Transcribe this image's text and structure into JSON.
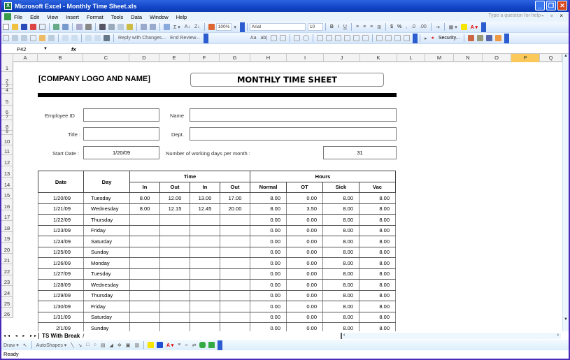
{
  "window": {
    "title": "Microsoft Excel - Monthly Time Sheet.xls",
    "app_icon": "excel-icon"
  },
  "menu": {
    "items": [
      "File",
      "Edit",
      "View",
      "Insert",
      "Format",
      "Tools",
      "Data",
      "Window",
      "Help"
    ],
    "help_placeholder": "Type a question for help",
    "doc_controls": "- ▫ ×"
  },
  "toolbar_standard": {
    "zoom": "100%"
  },
  "toolbar_formatting": {
    "font": "Arial",
    "font_size": "10",
    "bold": "B",
    "italic": "I",
    "underline": "U",
    "currency": "$",
    "percent": "%"
  },
  "toolbar_reviewing": {
    "reply_label": "Reply with Changes...",
    "end_review_label": "End Review..."
  },
  "toolbar_security": {
    "security_label": "Security..."
  },
  "formula_bar": {
    "cell_ref": "P42",
    "fx": "fx",
    "content": ""
  },
  "columns": [
    "A",
    "B",
    "C",
    "D",
    "E",
    "F",
    "G",
    "H",
    "I",
    "J",
    "K",
    "L",
    "M",
    "N",
    "O",
    "P",
    "Q"
  ],
  "selected_column": "P",
  "rows": [
    "1",
    "2",
    "3",
    "4",
    "5",
    "6",
    "7",
    "8",
    "9",
    "10",
    "11",
    "12",
    "13",
    "14",
    "15",
    "16",
    "17",
    "18",
    "19",
    "20",
    "21",
    "22",
    "23",
    "24",
    "25",
    "26"
  ],
  "sheet": {
    "company": "[COMPANY LOGO AND NAME]",
    "title": "MONTHLY TIME SHEET",
    "fields": {
      "employee_id_label": "Employee ID",
      "employee_id": "",
      "name_label": "Name",
      "name": "",
      "title_label": "Title :",
      "title": "",
      "dept_label": "Dept.",
      "dept": "",
      "start_date_label": "Start Date :",
      "start_date": "1/20/09",
      "working_days_label": "Number of working days per month :",
      "working_days": "31"
    },
    "table": {
      "h_date": "Date",
      "h_day": "Day",
      "h_time": "Time",
      "h_hours": "Hours",
      "time_cols": [
        "In",
        "Out",
        "In",
        "Out"
      ],
      "hours_cols": [
        "Normal",
        "OT",
        "Sick",
        "Vac"
      ],
      "rows": [
        {
          "date": "1/20/09",
          "day": "Tuesday",
          "in1": "8.00",
          "out1": "12.00",
          "in2": "13.00",
          "out2": "17.00",
          "normal": "8.00",
          "ot": "0.00",
          "sick": "8.00",
          "vac": "8.00"
        },
        {
          "date": "1/21/09",
          "day": "Wednesday",
          "in1": "8.00",
          "out1": "12.15",
          "in2": "12.45",
          "out2": "20.00",
          "normal": "8.00",
          "ot": "3.50",
          "sick": "8.00",
          "vac": "8.00"
        },
        {
          "date": "1/22/09",
          "day": "Thursday",
          "in1": "",
          "out1": "",
          "in2": "",
          "out2": "",
          "normal": "0.00",
          "ot": "0.00",
          "sick": "8.00",
          "vac": "8.00"
        },
        {
          "date": "1/23/09",
          "day": "Friday",
          "in1": "",
          "out1": "",
          "in2": "",
          "out2": "",
          "normal": "0.00",
          "ot": "0.00",
          "sick": "8.00",
          "vac": "8.00"
        },
        {
          "date": "1/24/09",
          "day": "Saturday",
          "in1": "",
          "out1": "",
          "in2": "",
          "out2": "",
          "normal": "0.00",
          "ot": "0.00",
          "sick": "8.00",
          "vac": "8.00"
        },
        {
          "date": "1/25/09",
          "day": "Sunday",
          "in1": "",
          "out1": "",
          "in2": "",
          "out2": "",
          "normal": "0.00",
          "ot": "0.00",
          "sick": "8.00",
          "vac": "8.00"
        },
        {
          "date": "1/26/09",
          "day": "Monday",
          "in1": "",
          "out1": "",
          "in2": "",
          "out2": "",
          "normal": "0.00",
          "ot": "0.00",
          "sick": "8.00",
          "vac": "8.00"
        },
        {
          "date": "1/27/09",
          "day": "Tuesday",
          "in1": "",
          "out1": "",
          "in2": "",
          "out2": "",
          "normal": "0.00",
          "ot": "0.00",
          "sick": "8.00",
          "vac": "8.00"
        },
        {
          "date": "1/28/09",
          "day": "Wednesday",
          "in1": "",
          "out1": "",
          "in2": "",
          "out2": "",
          "normal": "0.00",
          "ot": "0.00",
          "sick": "8.00",
          "vac": "8.00"
        },
        {
          "date": "1/29/09",
          "day": "Thursday",
          "in1": "",
          "out1": "",
          "in2": "",
          "out2": "",
          "normal": "0.00",
          "ot": "0.00",
          "sick": "8.00",
          "vac": "8.00"
        },
        {
          "date": "1/30/09",
          "day": "Friday",
          "in1": "",
          "out1": "",
          "in2": "",
          "out2": "",
          "normal": "0.00",
          "ot": "0.00",
          "sick": "8.00",
          "vac": "8.00"
        },
        {
          "date": "1/31/09",
          "day": "Saturday",
          "in1": "",
          "out1": "",
          "in2": "",
          "out2": "",
          "normal": "0.00",
          "ot": "0.00",
          "sick": "8.00",
          "vac": "8.00"
        },
        {
          "date": "2/1/09",
          "day": "Sunday",
          "in1": "",
          "out1": "",
          "in2": "",
          "out2": "",
          "normal": "0.00",
          "ot": "0.00",
          "sick": "8.00",
          "vac": "8.00"
        }
      ]
    }
  },
  "sheet_tabs": {
    "nav": "◂◂ ◂ ▸ ▸▸",
    "active": "TS With Break"
  },
  "draw_toolbar": {
    "draw_label": "Draw ▾",
    "autoshapes_label": "AutoShapes ▾"
  },
  "status": {
    "text": "Ready"
  },
  "colors": {
    "title_bar": "#1246c8",
    "selected_col": "#fbc959",
    "toolbar_bg": "#d6e7fb"
  }
}
